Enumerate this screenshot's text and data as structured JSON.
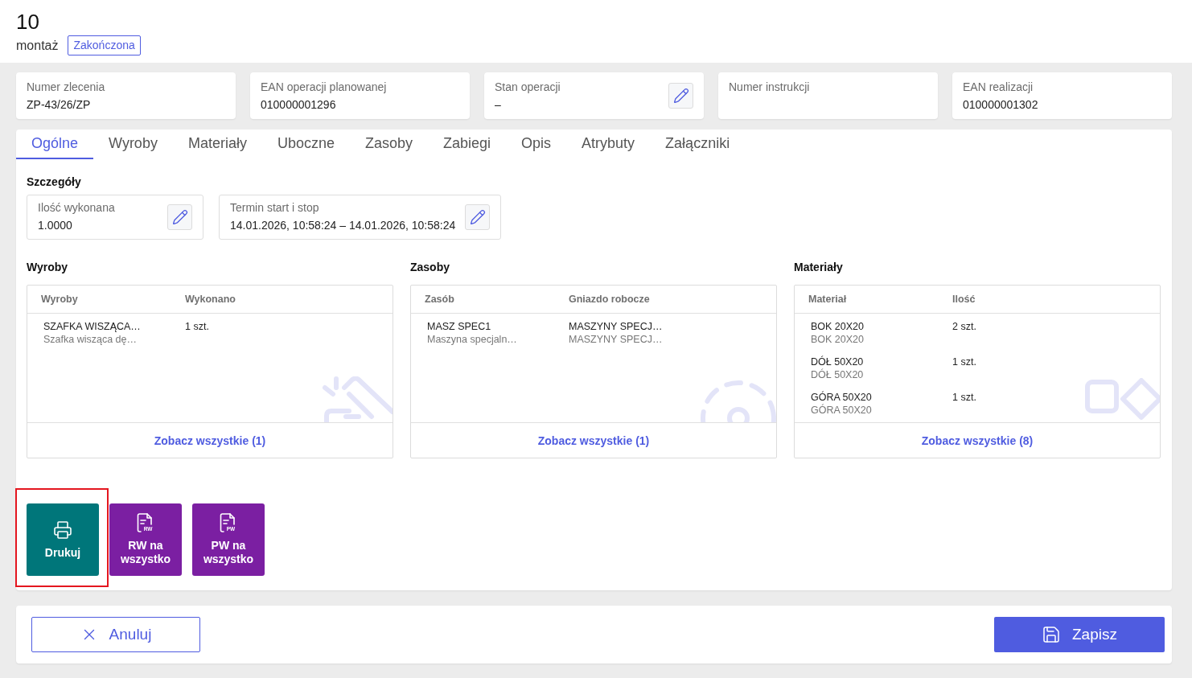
{
  "header": {
    "title": "10",
    "subtitle": "montaż",
    "status_badge": "Zakończona"
  },
  "info_fields": [
    {
      "label": "Numer zlecenia",
      "value": "ZP-43/26/ZP",
      "editable": false
    },
    {
      "label": "EAN operacji planowanej",
      "value": "010000001296",
      "editable": false
    },
    {
      "label": "Stan operacji",
      "value": "–",
      "editable": true
    },
    {
      "label": "Numer instrukcji",
      "editable": false
    },
    {
      "label": "EAN realizacji",
      "value": "010000001302",
      "editable": false
    }
  ],
  "tabs": [
    {
      "label": "Ogólne",
      "selected": true
    },
    {
      "label": "Wyroby",
      "selected": false
    },
    {
      "label": "Materiały",
      "selected": false
    },
    {
      "label": "Uboczne",
      "selected": false
    },
    {
      "label": "Zasoby",
      "selected": false
    },
    {
      "label": "Zabiegi",
      "selected": false
    },
    {
      "label": "Opis",
      "selected": false
    },
    {
      "label": "Atrybuty",
      "selected": false
    },
    {
      "label": "Załączniki",
      "selected": false
    }
  ],
  "details": {
    "title": "Szczegóły",
    "fields": [
      {
        "label": "Ilość wykonana",
        "value": "1.0000",
        "editable": true
      },
      {
        "label": "Termin start i stop",
        "value": "14.01.2026, 10:58:24 – 14.01.2026, 10:58:24",
        "editable": true
      }
    ]
  },
  "panels": [
    {
      "title": "Wyroby",
      "kind": "products",
      "columns": [
        "Wyroby",
        "Wykonano"
      ],
      "rows": [
        [
          {
            "primary": "SZAFKA WISZĄCA…",
            "secondary": "Szafka wisząca dę…"
          },
          {
            "primary": "1 szt."
          }
        ]
      ],
      "link": "Zobacz wszystkie (1)"
    },
    {
      "title": "Zasoby",
      "kind": "resources",
      "columns": [
        "Zasób",
        "Gniazdo robocze"
      ],
      "rows": [
        [
          {
            "primary": "MASZ SPEC1",
            "secondary": "Maszyna specjaln…"
          },
          {
            "primary": "MASZYNY SPECJ…",
            "secondary": "MASZYNY SPECJ…"
          }
        ]
      ],
      "link": "Zobacz wszystkie (1)"
    },
    {
      "title": "Materiały",
      "kind": "materials",
      "columns": [
        "Materiał",
        "Ilość"
      ],
      "rows": [
        [
          {
            "primary": "BOK 20X20",
            "secondary": "BOK 20X20"
          },
          {
            "primary": "2 szt."
          }
        ],
        [
          {
            "primary": "DÓŁ 50X20",
            "secondary": "DÓŁ 50X20"
          },
          {
            "primary": "1 szt."
          }
        ],
        [
          {
            "primary": "GÓRA 50X20",
            "secondary": "GÓRA 50X20"
          },
          {
            "primary": "1 szt."
          }
        ]
      ],
      "link": "Zobacz wszystkie (8)"
    }
  ],
  "actions": [
    {
      "label": "Drukuj",
      "kind": "print",
      "highlighted": true
    },
    {
      "label": "RW na wszystko",
      "kind": "document",
      "icon_caption": "RW",
      "highlighted": false
    },
    {
      "label": "PW na wszystko",
      "kind": "document",
      "icon_caption": "PW",
      "highlighted": false
    }
  ],
  "footer": {
    "cancel": "Anuluj",
    "save": "Zapisz"
  }
}
